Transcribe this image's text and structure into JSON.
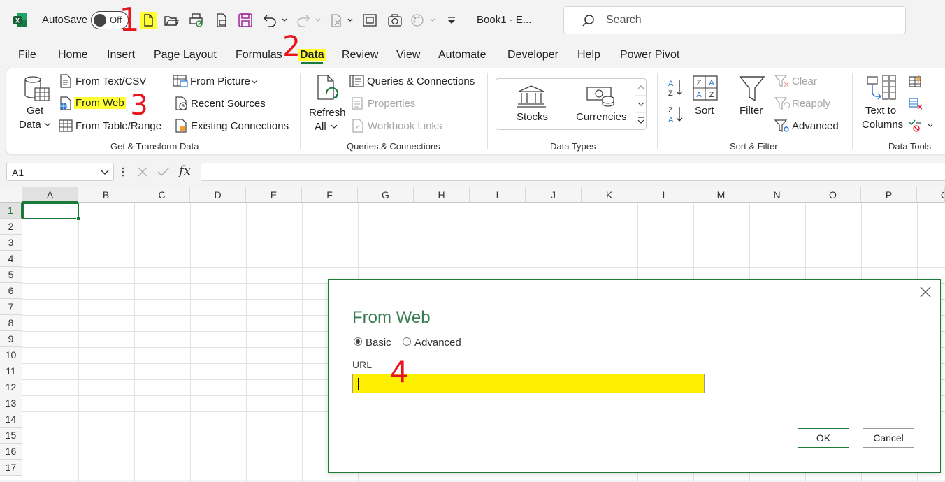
{
  "titlebar": {
    "autosave_label": "AutoSave",
    "autosave_state": "Off",
    "book_title": "Book1  -  E...",
    "search_placeholder": "Search"
  },
  "tabs": [
    "File",
    "Home",
    "Insert",
    "Page Layout",
    "Formulas",
    "Data",
    "Review",
    "View",
    "Automate",
    "Developer",
    "Help",
    "Power Pivot"
  ],
  "active_tab": "Data",
  "ribbon": {
    "get_transform": {
      "get_data_line1": "Get",
      "get_data_line2": "Data",
      "from_text_csv": "From Text/CSV",
      "from_web": "From Web",
      "from_table_range": "From Table/Range",
      "from_picture": "From Picture",
      "recent_sources": "Recent Sources",
      "existing_connections": "Existing Connections",
      "group_label": "Get & Transform Data"
    },
    "queries": {
      "refresh_line1": "Refresh",
      "refresh_line2": "All",
      "queries_connections": "Queries & Connections",
      "properties": "Properties",
      "workbook_links": "Workbook Links",
      "group_label": "Queries & Connections"
    },
    "data_types": {
      "stocks": "Stocks",
      "currencies": "Currencies",
      "group_label": "Data Types"
    },
    "sort_filter": {
      "sort": "Sort",
      "filter": "Filter",
      "clear": "Clear",
      "reapply": "Reapply",
      "advanced": "Advanced",
      "group_label": "Sort & Filter"
    },
    "data_tools": {
      "text_to_columns_line1": "Text to",
      "text_to_columns_line2": "Columns",
      "group_label": "Data Tools"
    }
  },
  "formula_bar": {
    "name_box": "A1",
    "fx": "fx"
  },
  "grid": {
    "columns": [
      "A",
      "B",
      "C",
      "D",
      "E",
      "F",
      "G",
      "H",
      "I",
      "J",
      "K",
      "L",
      "M",
      "N",
      "O",
      "P",
      "Q"
    ],
    "rows": [
      "1",
      "2",
      "3",
      "4",
      "5",
      "6",
      "7",
      "8",
      "9",
      "10",
      "11",
      "12",
      "13",
      "14",
      "15",
      "16",
      "17"
    ],
    "selected_cell": "A1"
  },
  "dialog": {
    "title": "From Web",
    "radio_basic": "Basic",
    "radio_advanced": "Advanced",
    "selected_mode": "Basic",
    "url_label": "URL",
    "url_value": "",
    "ok": "OK",
    "cancel": "Cancel"
  },
  "annotations": [
    "1",
    "2",
    "3",
    "4"
  ],
  "colors": {
    "highlight": "#ffff33",
    "excel_green": "#1a7a3a",
    "annotation_red": "#e8141e"
  }
}
